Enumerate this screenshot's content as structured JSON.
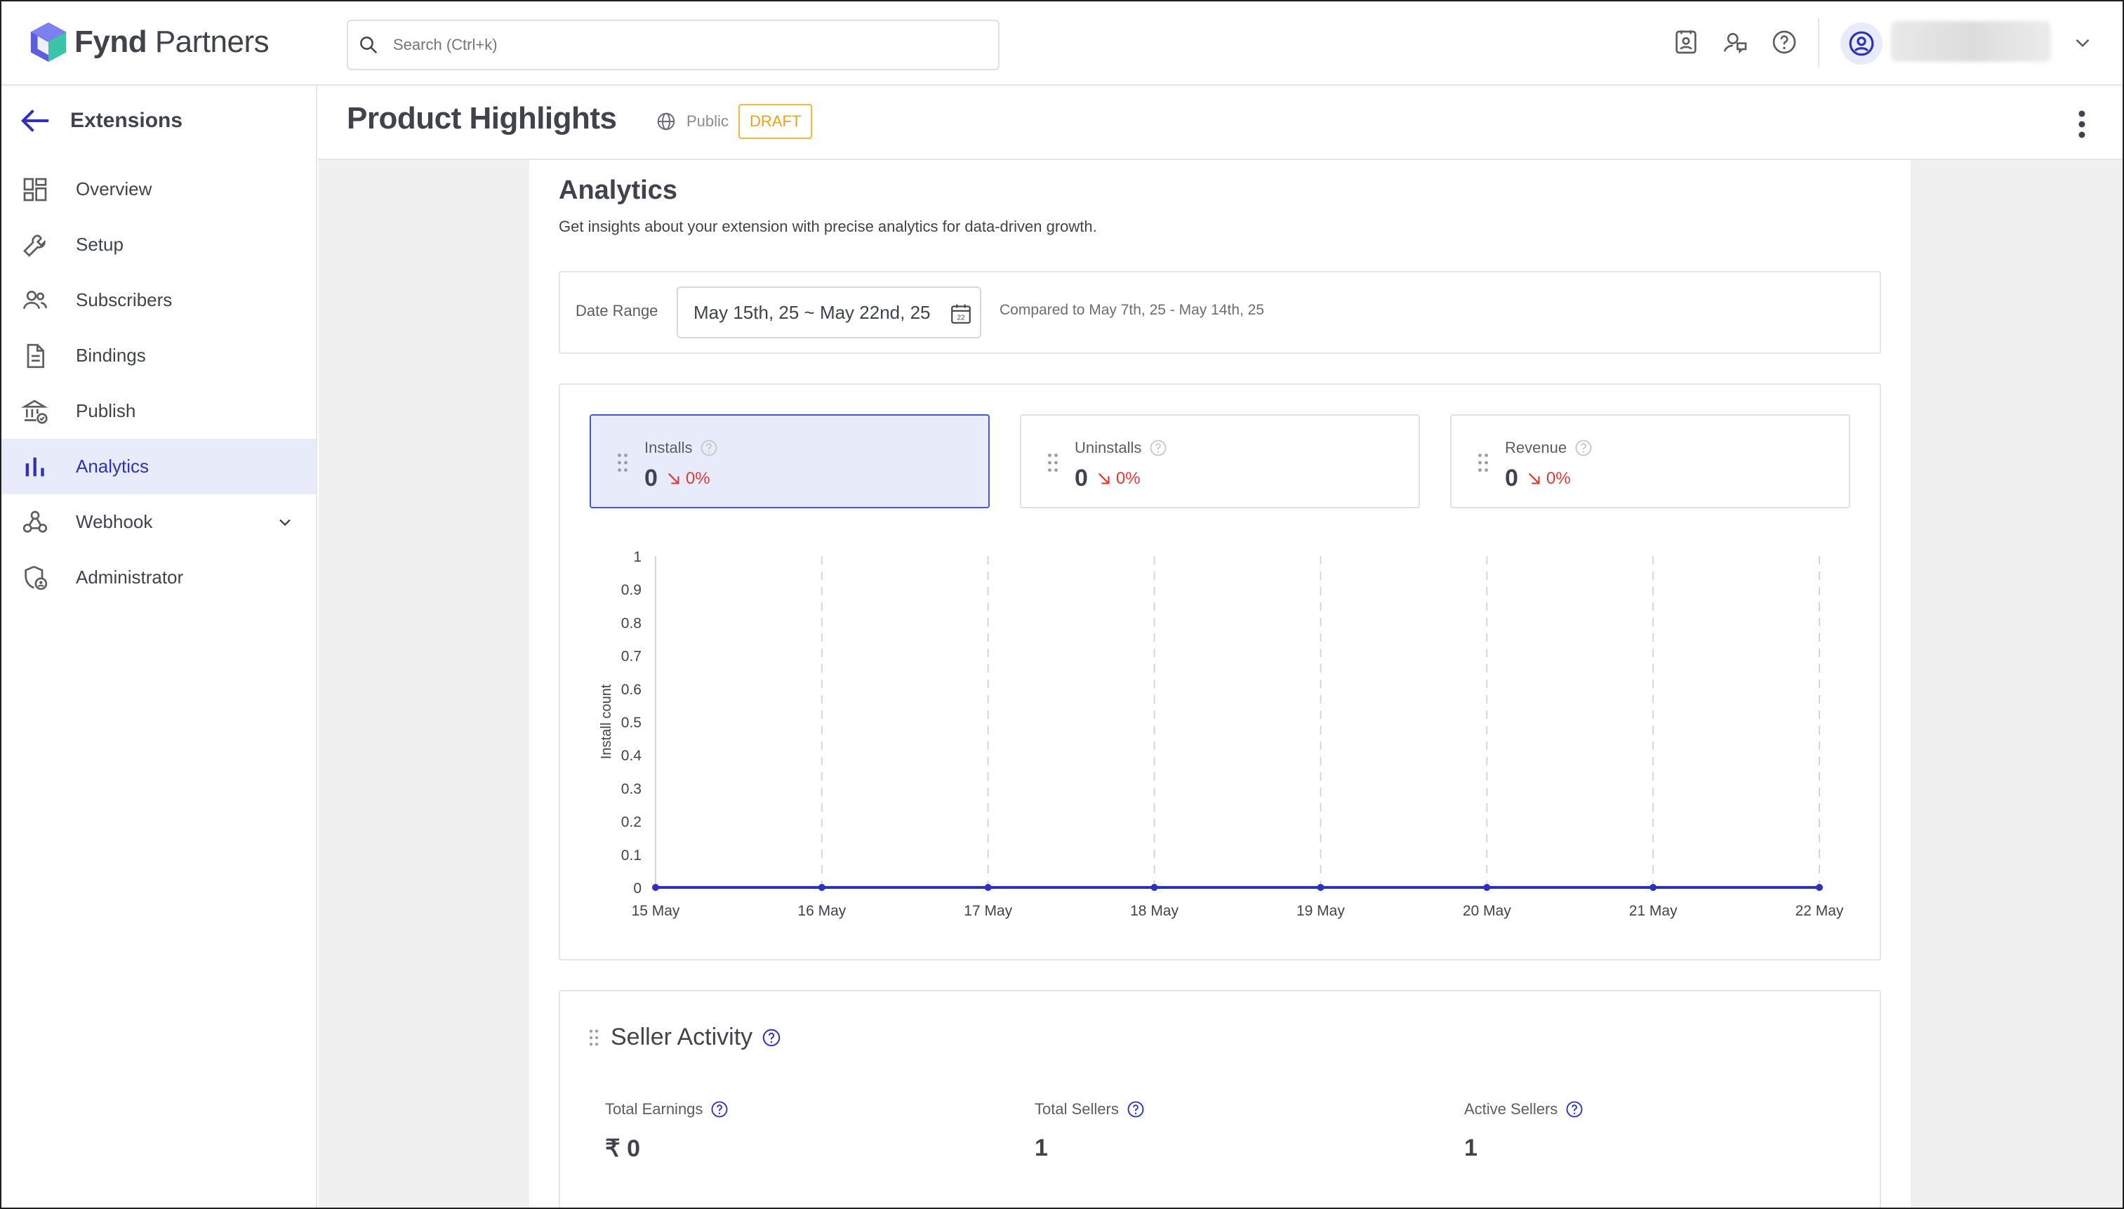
{
  "brand": {
    "name_bold": "Fynd",
    "name_rest": " Partners"
  },
  "search": {
    "placeholder": "Search (Ctrl+k)"
  },
  "sidebar": {
    "back_label": "Extensions",
    "items": [
      {
        "label": "Overview",
        "icon": "grid-icon"
      },
      {
        "label": "Setup",
        "icon": "wrench-icon"
      },
      {
        "label": "Subscribers",
        "icon": "users-icon"
      },
      {
        "label": "Bindings",
        "icon": "document-icon"
      },
      {
        "label": "Publish",
        "icon": "bank-icon"
      },
      {
        "label": "Analytics",
        "icon": "bar-chart-icon",
        "active": true
      },
      {
        "label": "Webhook",
        "icon": "webhook-icon"
      },
      {
        "label": "Administrator",
        "icon": "shield-user-icon"
      }
    ]
  },
  "header": {
    "title": "Product Highlights",
    "visibility": "Public",
    "status": "DRAFT"
  },
  "analytics": {
    "title": "Analytics",
    "subtitle": "Get insights about your extension with precise analytics for data-driven growth.",
    "date_range_label": "Date Range",
    "date_range_value": "May 15th, 25 ~ May 22nd, 25",
    "compare_text": "Compared to May 7th, 25 - May 14th, 25"
  },
  "metrics": [
    {
      "label": "Installs",
      "value": "0",
      "delta": "0%",
      "selected": true
    },
    {
      "label": "Uninstalls",
      "value": "0",
      "delta": "0%"
    },
    {
      "label": "Revenue",
      "value": "0",
      "delta": "0%"
    }
  ],
  "chart_data": {
    "type": "line",
    "x": [
      "15 May",
      "16 May",
      "17 May",
      "18 May",
      "19 May",
      "20 May",
      "21 May",
      "22 May"
    ],
    "series": [
      {
        "values": [
          0,
          0,
          0,
          0,
          0,
          0,
          0,
          0
        ]
      }
    ],
    "ylabel": "Install count",
    "yticks": [
      "0",
      "0.1",
      "0.2",
      "0.3",
      "0.4",
      "0.5",
      "0.6",
      "0.7",
      "0.8",
      "0.9",
      "1"
    ],
    "ylim": [
      0,
      1
    ],
    "grid": "vertical dashed",
    "color": "#2e31be"
  },
  "seller_activity": {
    "title": "Seller Activity",
    "stats": [
      {
        "label": "Total Earnings",
        "value": "₹ 0"
      },
      {
        "label": "Total Sellers",
        "value": "1"
      },
      {
        "label": "Active Sellers",
        "value": "1"
      }
    ]
  },
  "colors": {
    "accent": "#2e31be",
    "active_bg": "#e7ebfa",
    "draft": "#e8a31a",
    "negative": "#e03a3a"
  }
}
